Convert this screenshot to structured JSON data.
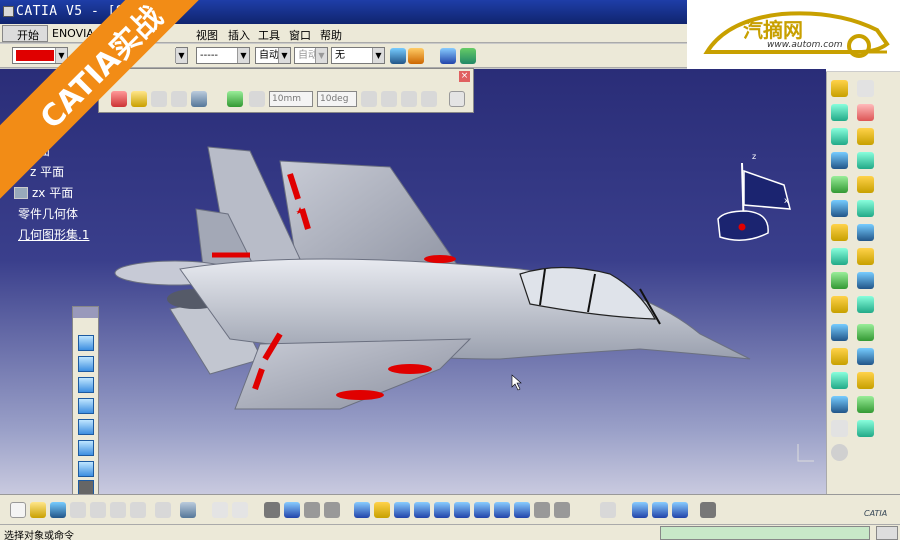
{
  "window": {
    "title": "CATIA V5 - [S"
  },
  "menu": {
    "items": [
      "开始",
      "ENOVIA V",
      "视图",
      "插入",
      "工具",
      "窗口",
      "帮助"
    ]
  },
  "property_toolbar": {
    "color_label": "",
    "color_value": "#e00000",
    "linetype_value": "-----",
    "thickness_value": "自动",
    "point_value": "自动",
    "layer_value": "无"
  },
  "logo": {
    "brand": "汽摘网",
    "url": "www.autom.com"
  },
  "banner": {
    "text": "CATIA实战"
  },
  "floating_toolbar": {
    "spin1": "10mm",
    "spin2": "10deg"
  },
  "tree": {
    "items": [
      "面",
      "z 平面",
      "zx 平面",
      "零件几何体",
      "几何图形集.1"
    ]
  },
  "status": {
    "text": "选择对象或命令"
  },
  "compass": {
    "axis_z": "z",
    "axis_x": "x"
  },
  "catia_mark": "CATIA"
}
